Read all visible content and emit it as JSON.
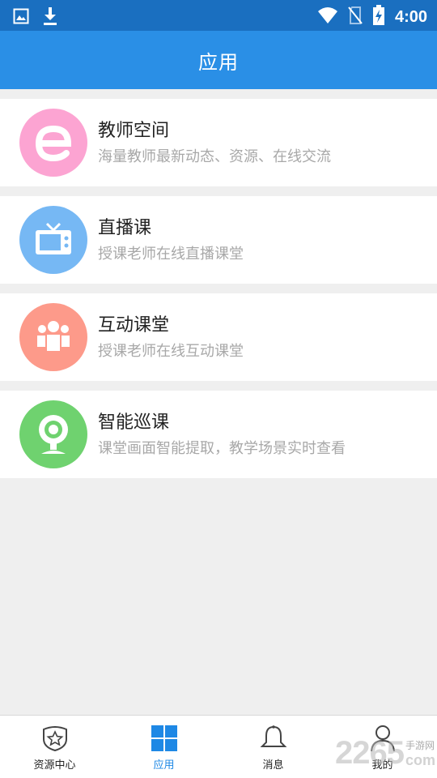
{
  "status_bar": {
    "time": "4:00",
    "icons": [
      "image-icon",
      "download-icon",
      "wifi-icon",
      "no-sim-icon",
      "battery-charging-icon"
    ]
  },
  "header": {
    "title": "应用"
  },
  "apps": [
    {
      "name": "教师空间",
      "desc": "海量教师最新动态、资源、在线交流",
      "icon": "letter-e-icon",
      "color": "#fca4d2"
    },
    {
      "name": "直播课",
      "desc": "授课老师在线直播课堂",
      "icon": "tv-icon",
      "color": "#76b8f4"
    },
    {
      "name": "互动课堂",
      "desc": "授课老师在线互动课堂",
      "icon": "group-icon",
      "color": "#fd9a8a"
    },
    {
      "name": "智能巡课",
      "desc": "课堂画面智能提取，教学场景实时查看",
      "icon": "webcam-icon",
      "color": "#6fd26f"
    }
  ],
  "bottom_nav": [
    {
      "label": "资源中心",
      "icon": "shield-star-icon",
      "active": false
    },
    {
      "label": "应用",
      "icon": "grid-icon",
      "active": true
    },
    {
      "label": "消息",
      "icon": "bell-icon",
      "active": false
    },
    {
      "label": "我的",
      "icon": "person-icon",
      "active": false
    }
  ],
  "watermark": {
    "number": "2265",
    "cn": "手游网",
    "domain": "com"
  },
  "colors": {
    "status_bar": "#1a6fc0",
    "header": "#2a8fe6",
    "active_tab": "#1e88e5"
  }
}
